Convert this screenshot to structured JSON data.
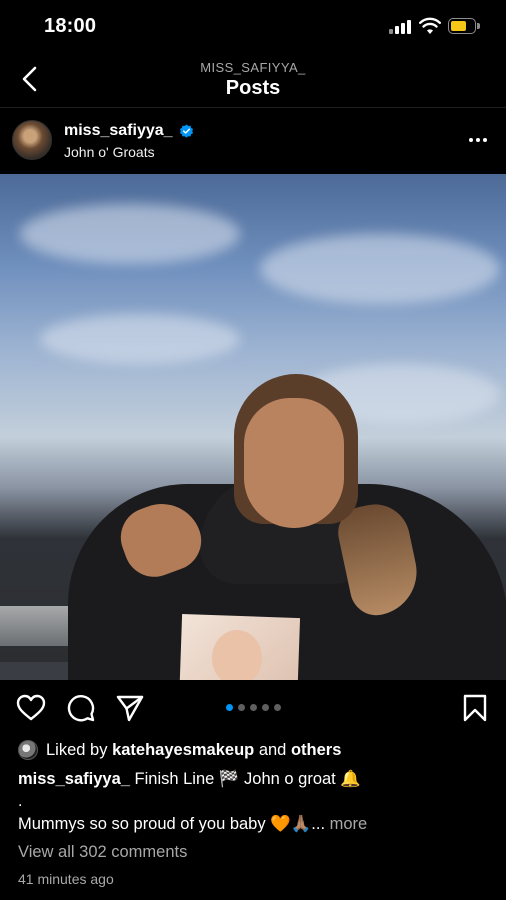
{
  "status_bar": {
    "time": "18:00"
  },
  "nav": {
    "username": "MISS_SAFIYYA_",
    "title": "Posts"
  },
  "post": {
    "author": "miss_safiyya_",
    "location": "John o' Groats",
    "carousel": {
      "count": 5,
      "active_index": 0
    },
    "liked_by_prefix": "Liked by",
    "liked_by_user": "katehayesmakeup",
    "liked_by_and": "and",
    "liked_by_others": "others",
    "caption_author": "miss_safiyya_",
    "caption_line1": "Finish Line 🏁 John o groat 🔔",
    "caption_dot": ".",
    "caption_line2": "Mummys so so proud of you baby 🧡🙏🏽...",
    "more_label": "more",
    "view_comments": "View all 302 comments",
    "timestamp": "41 minutes ago"
  },
  "icons": {
    "back": "chevron-left-icon",
    "verified": "verified-badge-icon",
    "more": "more-options-icon",
    "like": "heart-icon",
    "comment": "comment-bubble-icon",
    "share": "paper-plane-icon",
    "save": "bookmark-icon"
  },
  "colors": {
    "background": "#000000",
    "text": "#ffffff",
    "muted": "#a8a8a8",
    "accent": "#0095f6",
    "battery": "#f5c518"
  }
}
